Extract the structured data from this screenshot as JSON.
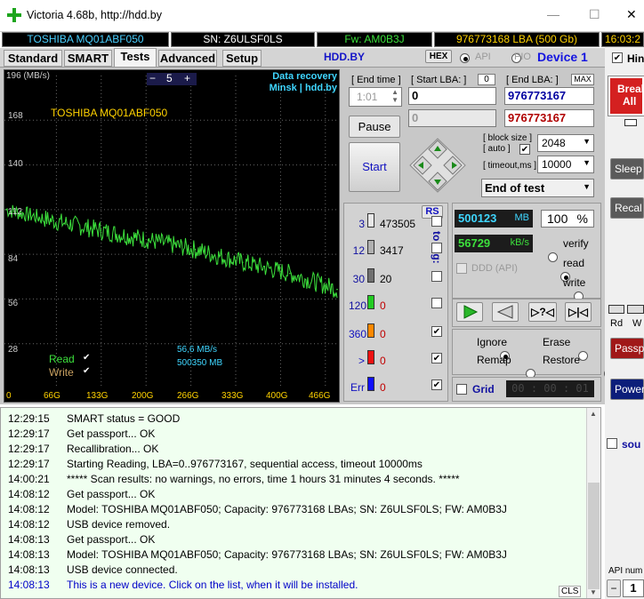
{
  "window": {
    "title": "Victoria 4.68b, http://hdd.by",
    "close_glyph": "✕",
    "max_glyph": "☐",
    "min_glyph": "—"
  },
  "info": {
    "model": "TOSHIBA MQ01ABF050",
    "serial": "SN: Z6ULSF0LS",
    "firmware": "Fw: AM0B3J",
    "capacity": "976773168 LBA (500 Gb)",
    "clock": "16:03:2"
  },
  "tabs": [
    {
      "label": "Standard"
    },
    {
      "label": "SMART"
    },
    {
      "label": "Tests"
    },
    {
      "label": "Advanced"
    },
    {
      "label": "Setup"
    }
  ],
  "toolbar": {
    "site": "HDD.BY",
    "hex": "HEX",
    "api": "API",
    "pio": "PIO",
    "device": "Device 1",
    "hints": "Hin"
  },
  "graph": {
    "ymax_label": "196 (MB/s)",
    "zoom_minus": "−",
    "zoom_value": "5",
    "zoom_plus": "+",
    "watermark_1": "Data recovery",
    "watermark_2": "Minsk | hdd.by",
    "drive_label": "TOSHIBA MQ01ABF050",
    "y_ticks": [
      "168",
      "140",
      "112",
      "84",
      "56",
      "28"
    ],
    "x_ticks": [
      "0",
      "66G",
      "133G",
      "200G",
      "266G",
      "333G",
      "400G",
      "466G"
    ],
    "read_label": "Read",
    "write_label": "Write",
    "speed_text": "56,6 MB/s",
    "size_text": "500350 MB",
    "read_check": "✔",
    "write_check": "✔"
  },
  "chart_data": {
    "type": "line",
    "title": "TOSHIBA MQ01ABF050",
    "ylabel": "MB/s",
    "ylim": [
      0,
      196
    ],
    "x": [
      "0",
      "66G",
      "133G",
      "200G",
      "266G",
      "333G",
      "400G",
      "466G"
    ],
    "series": [
      {
        "name": "Read",
        "values": [
          112,
          105,
          99,
          93,
          87,
          79,
          72,
          62
        ]
      }
    ]
  },
  "end_time": {
    "label": "[ End time ]",
    "value": "1:01"
  },
  "start_lba": {
    "label": "[ Start LBA: ]",
    "zero": "0",
    "value": "0",
    "value2": "0"
  },
  "end_lba": {
    "label": "[ End LBA: ]",
    "max": "MAX",
    "value": "976773167",
    "value2": "976773167"
  },
  "buttons": {
    "pause": "Pause",
    "start": "Start",
    "break_1": "Break",
    "break_2": "All",
    "sleep": "Sleep",
    "recal": "Recal",
    "passp": "Passp",
    "power": "Power"
  },
  "block": {
    "label": "[ block size ]",
    "auto": "[ auto ]",
    "auto_check": "✔",
    "value": "2048"
  },
  "timeout": {
    "label": "[ timeout,ms ]",
    "value": "10000"
  },
  "end_action": "End of test",
  "rs": "RS",
  "to_log": "to log:",
  "blocks": [
    {
      "ms": "3",
      "count": "473505",
      "color": "#e8e8e8",
      "check": ""
    },
    {
      "ms": "12",
      "count": "3417",
      "color": "#b0b0b0",
      "check": ""
    },
    {
      "ms": "30",
      "count": "20",
      "color": "#707070",
      "check": ""
    },
    {
      "ms": "120",
      "count": "0",
      "color": "#22cc22",
      "check": ""
    },
    {
      "ms": "360",
      "count": "0",
      "color": "#ff8800",
      "check": "✔"
    },
    {
      "ms": ">",
      "count": "0",
      "color": "#ee1111",
      "check": "✔"
    },
    {
      "ms": "Err",
      "count": "0",
      "color": "#1010ff",
      "check": "✔"
    }
  ],
  "progress": {
    "mb": "500123",
    "mb_unit": "MB",
    "percent": "100",
    "percent_unit": "%",
    "speed": "56729",
    "speed_unit": "kB/s"
  },
  "modes": {
    "verify": "verify",
    "read": "read",
    "write": "write",
    "ddd": "DDD (API)"
  },
  "repair": {
    "ignore": "Ignore",
    "erase": "Erase",
    "remap": "Remap",
    "restore": "Restore"
  },
  "grid": {
    "label": "Grid",
    "timer": "00 : 00 : 01"
  },
  "right": {
    "rd": "Rd",
    "wr": "W",
    "sound": "sou",
    "api_num": "API num",
    "api_minus": "−",
    "api_value": "1"
  },
  "log": [
    {
      "time": "12:29:15",
      "text": "SMART status = GOOD",
      "blue": false
    },
    {
      "time": "12:29:17",
      "text": "Get passport... OK",
      "blue": false
    },
    {
      "time": "12:29:17",
      "text": "Recallibration... OK",
      "blue": false
    },
    {
      "time": "12:29:17",
      "text": "Starting Reading, LBA=0..976773167, sequential access, timeout 10000ms",
      "blue": false
    },
    {
      "time": "14:00:21",
      "text": "***** Scan results: no warnings, no errors, time 1 hours 31 minutes 4 seconds.  *****",
      "blue": false
    },
    {
      "time": "14:08:12",
      "text": "Get passport... OK",
      "blue": false
    },
    {
      "time": "14:08:12",
      "text": "Model: TOSHIBA MQ01ABF050; Capacity: 976773168 LBAs; SN: Z6ULSF0LS; FW: AM0B3J",
      "blue": false
    },
    {
      "time": "14:08:12",
      "text": "USB device removed.",
      "blue": false
    },
    {
      "time": "14:08:13",
      "text": "Get passport... OK",
      "blue": false
    },
    {
      "time": "14:08:13",
      "text": "Model: TOSHIBA MQ01ABF050; Capacity: 976773168 LBAs; SN: Z6ULSF0LS; FW: AM0B3J",
      "blue": false
    },
    {
      "time": "14:08:13",
      "text": "USB device connected.",
      "blue": false
    },
    {
      "time": "14:08:13",
      "text": "This is a new device. Click on the list, when it will be installed.",
      "blue": true
    }
  ],
  "cls": "CLS"
}
